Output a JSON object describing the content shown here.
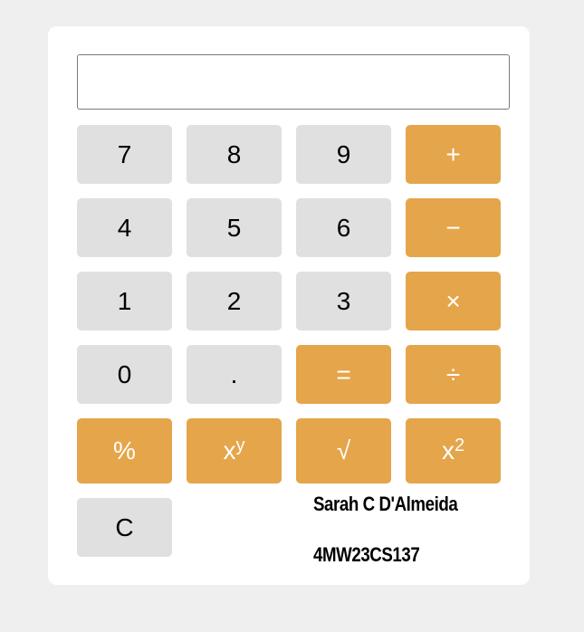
{
  "display": {
    "value": "",
    "placeholder": ""
  },
  "keys": {
    "seven": "7",
    "eight": "8",
    "nine": "9",
    "plus": "+",
    "four": "4",
    "five": "5",
    "six": "6",
    "minus": "−",
    "one": "1",
    "two": "2",
    "three": "3",
    "multiply": "×",
    "zero": "0",
    "decimal": ".",
    "equals": "=",
    "divide": "÷",
    "percent": "%",
    "power_base": "x",
    "power_exp": "y",
    "sqrt": "√",
    "square_base": "x",
    "square_exp": "2",
    "clear": "C"
  },
  "author": {
    "name": "Sarah C D'Almeida",
    "id": "4MW23CS137"
  },
  "colors": {
    "operator": "#e5a54a",
    "digit": "#e0e0e0",
    "background": "#efefef",
    "panel": "#ffffff"
  }
}
